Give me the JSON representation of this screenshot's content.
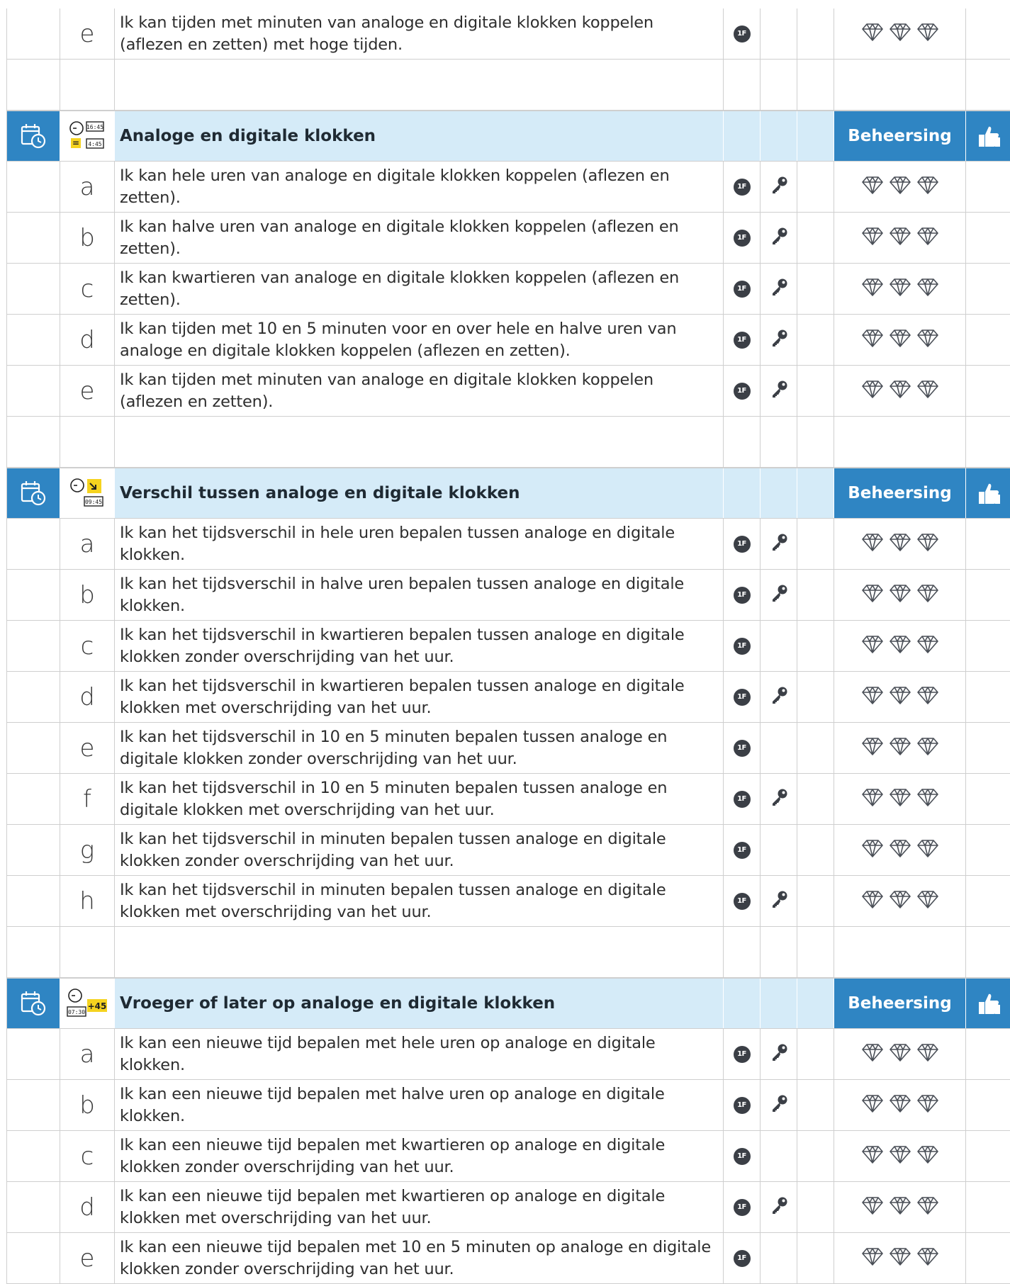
{
  "top_item": {
    "letter": "e",
    "text": "Ik kan tijden met minuten van analoge en digitale klokken koppelen (aflezen en zetten) met hoge tijden.",
    "badge": "1F",
    "key": false
  },
  "sections": [
    {
      "title": "Analoge en digitale klokken",
      "icon": "clock-equals-digital-icon",
      "icon_texts": [
        "16:45",
        "=",
        "4:45"
      ],
      "mastery_label": "Beheersing",
      "items": [
        {
          "letter": "a",
          "text": "Ik kan hele uren van analoge en digitale klokken koppelen (aflezen en zetten).",
          "badge": "1F",
          "key": true
        },
        {
          "letter": "b",
          "text": "Ik kan halve uren van analoge en digitale klokken koppelen (aflezen en zetten).",
          "badge": "1F",
          "key": true
        },
        {
          "letter": "c",
          "text": "Ik kan kwartieren van analoge en digitale klokken koppelen (aflezen en zetten).",
          "badge": "1F",
          "key": true
        },
        {
          "letter": "d",
          "text": "Ik kan tijden met 10 en 5 minuten voor en over hele en halve uren van analoge en digitale klokken koppelen (aflezen en zetten).",
          "badge": "1F",
          "key": true
        },
        {
          "letter": "e",
          "text": "Ik kan tijden met minuten van analoge en digitale klokken koppelen (aflezen en zetten).",
          "badge": "1F",
          "key": true
        }
      ]
    },
    {
      "title": "Verschil tussen analoge en digitale klokken",
      "icon": "clock-difference-icon",
      "icon_texts": [
        "09:45"
      ],
      "mastery_label": "Beheersing",
      "items": [
        {
          "letter": "a",
          "text": "Ik kan het tijdsverschil in hele uren bepalen tussen analoge en digitale klokken.",
          "badge": "1F",
          "key": true
        },
        {
          "letter": "b",
          "text": "Ik kan het tijdsverschil in halve uren bepalen tussen analoge en digitale klokken.",
          "badge": "1F",
          "key": true
        },
        {
          "letter": "c",
          "text": "Ik kan het tijdsverschil in kwartieren bepalen tussen analoge en digitale klokken zonder overschrijding van het uur.",
          "badge": "1F",
          "key": false
        },
        {
          "letter": "d",
          "text": "Ik kan het tijdsverschil in kwartieren bepalen tussen analoge en digitale klokken met overschrijding van het uur.",
          "badge": "1F",
          "key": true
        },
        {
          "letter": "e",
          "text": "Ik kan het tijdsverschil in 10 en 5 minuten bepalen tussen analoge en digitale klokken zonder overschrijding van het uur.",
          "badge": "1F",
          "key": false
        },
        {
          "letter": "f",
          "text": "Ik kan het tijdsverschil in 10 en 5 minuten bepalen tussen analoge en digitale klokken met overschrijding van het uur.",
          "badge": "1F",
          "key": true
        },
        {
          "letter": "g",
          "text": "Ik kan het tijdsverschil in minuten bepalen tussen analoge en digitale klokken zonder overschrijding van het uur.",
          "badge": "1F",
          "key": false
        },
        {
          "letter": "h",
          "text": "Ik kan het tijdsverschil in minuten bepalen tussen analoge en digitale klokken met overschrijding van het uur.",
          "badge": "1F",
          "key": true
        }
      ]
    },
    {
      "title": "Vroeger of later op analoge en digitale klokken",
      "icon": "clock-plus-minutes-icon",
      "icon_texts": [
        "07:30",
        "+45"
      ],
      "mastery_label": "Beheersing",
      "items": [
        {
          "letter": "a",
          "text": "Ik kan een nieuwe tijd bepalen met hele uren op analoge en digitale klokken.",
          "badge": "1F",
          "key": true
        },
        {
          "letter": "b",
          "text": "Ik kan een nieuwe tijd bepalen met halve uren op analoge en digitale klokken.",
          "badge": "1F",
          "key": true
        },
        {
          "letter": "c",
          "text": "Ik kan een nieuwe tijd bepalen met kwartieren op analoge en digitale klokken zonder overschrijding van het uur.",
          "badge": "1F",
          "key": false
        },
        {
          "letter": "d",
          "text": "Ik kan een nieuwe tijd bepalen met kwartieren op analoge en digitale klokken met overschrijding van het uur.",
          "badge": "1F",
          "key": true
        },
        {
          "letter": "e",
          "text": "Ik kan een nieuwe tijd bepalen met 10 en 5 minuten op analoge en digitale klokken zonder overschrijding van het uur.",
          "badge": "1F",
          "key": false
        }
      ]
    }
  ],
  "colors": {
    "header_blue": "#2f85c3",
    "header_light": "#d5ebf8",
    "badge_dark": "#3b3f46",
    "icon_yellow": "#f5d31f"
  }
}
